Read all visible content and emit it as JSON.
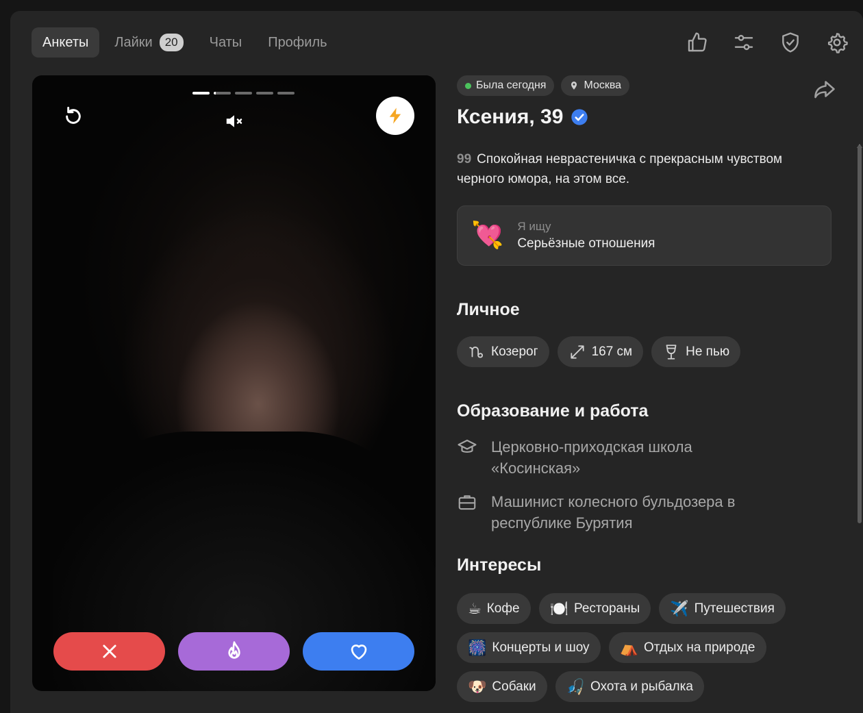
{
  "nav": {
    "tabs": [
      {
        "label": "Анкеты"
      },
      {
        "label": "Лайки",
        "badge": "20"
      },
      {
        "label": "Чаты"
      },
      {
        "label": "Профиль"
      }
    ],
    "icons": [
      "thumbs-up-icon",
      "filter-sliders-icon",
      "shield-check-icon",
      "gear-icon"
    ]
  },
  "photo": {
    "progress_count": 5,
    "active_index": 1
  },
  "profile": {
    "status": "Была сегодня",
    "city": "Москва",
    "name": "Ксения, 39",
    "verified": true,
    "bio_quote": "99",
    "bio": "Спокойная неврастеничка с прекрасным чувством черного юмора, на этом все.",
    "seeking_label": "Я ищу",
    "seeking_value": "Серьёзные отношения"
  },
  "personal": {
    "title": "Личное",
    "tags": [
      {
        "icon": "capricorn-icon",
        "label": "Козерог"
      },
      {
        "icon": "height-arrows-icon",
        "label": "167 см"
      },
      {
        "icon": "wine-glass-icon",
        "label": "Не пью"
      }
    ]
  },
  "education": {
    "title": "Образование и работа",
    "items": [
      {
        "icon": "graduation-cap-icon",
        "text": "Церковно-приходская школа «Косинская»"
      },
      {
        "icon": "briefcase-icon",
        "text": "Машинист колесного бульдозера в республике Бурятия"
      }
    ]
  },
  "interests": {
    "title": "Интересы",
    "tags": [
      {
        "emoji": "☕",
        "label": "Кофе"
      },
      {
        "emoji": "🍽️",
        "label": "Рестораны"
      },
      {
        "emoji": "✈️",
        "label": "Путешествия"
      },
      {
        "emoji": "🎆",
        "label": "Концерты и шоу"
      },
      {
        "emoji": "⛺",
        "label": "Отдых на природе"
      },
      {
        "emoji": "🐶",
        "label": "Собаки"
      },
      {
        "emoji": "🎣",
        "label": "Охота и рыбалка"
      }
    ]
  },
  "colors": {
    "dislike": "#e54b4b",
    "superlike": "#a76ad8",
    "like": "#3d7ef0",
    "boost_bolt": "#f5a623",
    "verified": "#3d7ef0",
    "online": "#4cc35d"
  }
}
